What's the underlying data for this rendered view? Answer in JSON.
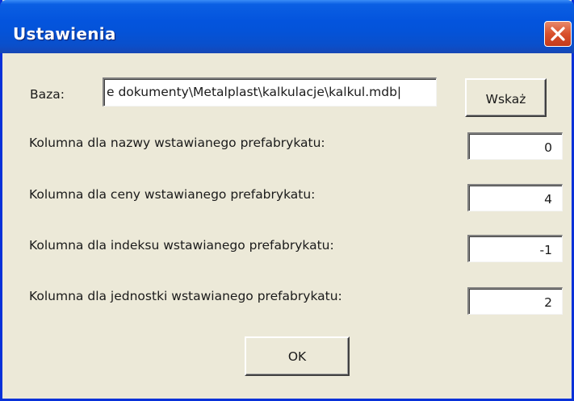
{
  "window": {
    "title": "Ustawienia"
  },
  "database": {
    "label": "Baza:",
    "path": "e dokumenty\\Metalplast\\kalkulacje\\kalkul.mdb|",
    "browse_button": "Wskaż"
  },
  "fields": [
    {
      "label": "Kolumna dla nazwy wstawianego prefabrykatu:",
      "value": "0"
    },
    {
      "label": "Kolumna dla ceny wstawianego prefabrykatu:",
      "value": "4"
    },
    {
      "label": "Kolumna dla indeksu wstawianego prefabrykatu:",
      "value": "-1"
    },
    {
      "label": "Kolumna dla jednostki wstawianego prefabrykatu:",
      "value": "2"
    }
  ],
  "ok_button": "OK",
  "icons": {
    "close": "close-icon"
  },
  "colors": {
    "titlebar": "#0454dd",
    "window_background": "#ece9d8",
    "close_button": "#d9502c"
  }
}
